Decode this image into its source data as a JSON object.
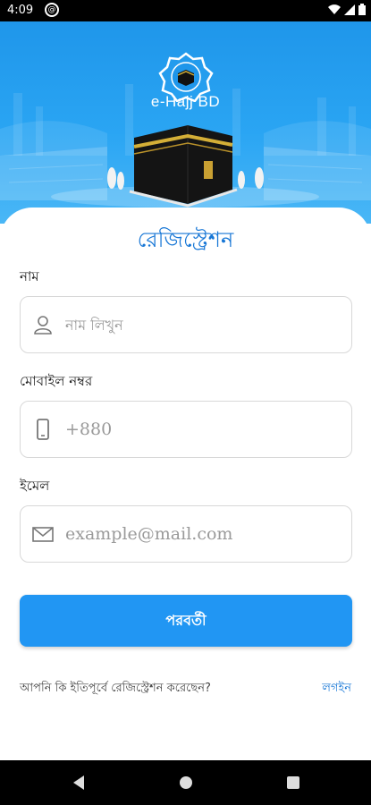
{
  "status_bar": {
    "time": "4:09",
    "icons": [
      "alert-icon",
      "wifi-icon",
      "signal-icon",
      "battery-icon"
    ]
  },
  "header": {
    "app_name": "e-Hajj BD"
  },
  "form": {
    "title": "রেজিস্ট্রেশন",
    "fields": [
      {
        "label": "নাম",
        "placeholder": "নাম লিখুন",
        "value": "",
        "icon": "person-icon"
      },
      {
        "label": "মোবাইল নম্বর",
        "placeholder": "+880",
        "value": "",
        "icon": "phone-icon"
      },
      {
        "label": "ইমেল",
        "placeholder": "example@mail.com",
        "value": "",
        "icon": "mail-icon"
      }
    ],
    "submit_label": "পরবর্তী",
    "login_prompt": "আপনি কি ইতিপূর্বে রেজিস্ট্রেশন করেছেন?",
    "login_link": "লগইন"
  },
  "navigation": {
    "buttons": [
      "back-icon",
      "home-icon",
      "recents-icon"
    ]
  },
  "colors": {
    "primary": "#2196F3",
    "title_blue": "#1877D6",
    "header_top": "#1F96EA"
  }
}
